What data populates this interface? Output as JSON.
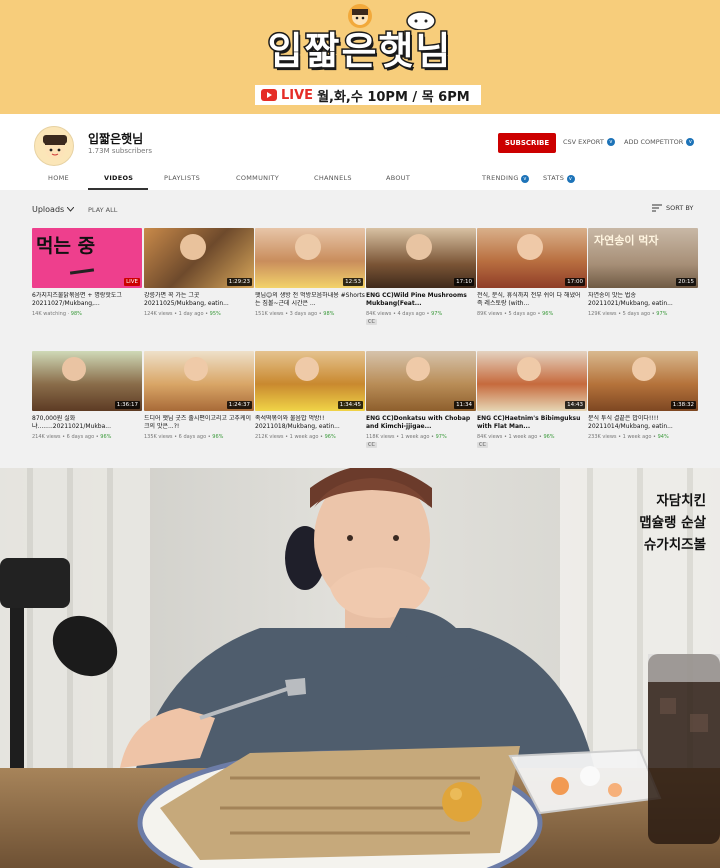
{
  "banner": {
    "title": "입짧은햇님",
    "live_word": "LIVE",
    "schedule": "월,화,수 10PM / 목 6PM"
  },
  "channel": {
    "name": "입짧은햇님",
    "subscribers": "1.73M subscribers",
    "subscribe": "SUBSCRIBE",
    "csv_export": "CSV EXPORT",
    "add_competitor": "ADD COMPETITOR",
    "tabs": [
      "HOME",
      "VIDEOS",
      "PLAYLISTS",
      "COMMUNITY",
      "CHANNELS",
      "ABOUT",
      "TRENDING",
      "STATS"
    ],
    "active_tab": "VIDEOS"
  },
  "videos_toolbar": {
    "uploads": "Uploads",
    "play_all": "PLAY ALL",
    "sort_by": "SORT BY"
  },
  "videos": [
    {
      "title": "6가지치즈불닭볶음면 + 명랑핫도그 20211027/Mukbang,...",
      "badge": "LIVE",
      "views": "14K watching",
      "age": "",
      "pct": "98%",
      "cc": false
    },
    {
      "title": "강릉가면 꼭 가는 그곳 20211025/Mukbang, eatin...",
      "badge": "1:29:23",
      "views": "124K views",
      "age": "1 day ago",
      "pct": "95%",
      "cc": false
    },
    {
      "title": "햇님😊의 생방 전 먹방모음하내용 #Shorts는 짐볼~근데 시간은 ...",
      "badge": "12:53",
      "views": "151K views",
      "age": "3 days ago",
      "pct": "98%",
      "cc": false
    },
    {
      "title": "ENG CC)Wild Pine Mushrooms Mukbang(Feat...",
      "badge": "17:10",
      "views": "84K views",
      "age": "4 days ago",
      "pct": "97%",
      "cc": true
    },
    {
      "title": "전식, 분식, 휴식까지 전부 쉬이 다 해냈어 즉 레스토랑 (with...",
      "badge": "17:00",
      "views": "89K views",
      "age": "5 days ago",
      "pct": "96%",
      "cc": false
    },
    {
      "title": "자연송이 맛는 법송 20211021/Mukbang, eatin...",
      "badge": "20:15",
      "views": "129K views",
      "age": "5 days ago",
      "pct": "97%",
      "cc": false
    },
    {
      "title": "870,000원 실화 냐........20211021/Mukba...",
      "badge": "1:36:17",
      "views": "214K views",
      "age": "6 days ago",
      "pct": "96%",
      "cc": false
    },
    {
      "title": "드디어 햇님 굿즈 출시편이고리고 고추케이크의 맛은...?!",
      "badge": "1:24:37",
      "views": "135K views",
      "age": "6 days ago",
      "pct": "96%",
      "cc": false
    },
    {
      "title": "족석떡볶이와 불음밥 먹방!! 20211018/Mukbang, eatin...",
      "badge": "1:34:45",
      "views": "212K views",
      "age": "1 week ago",
      "pct": "96%",
      "cc": false
    },
    {
      "title": "ENG CC)Donkatsu with Chobap and Kimchi-jjigae...",
      "badge": "11:34",
      "views": "118K views",
      "age": "1 week ago",
      "pct": "97%",
      "cc": true
    },
    {
      "title": "ENG CC)Haetnim's Bibimguksu with Flat Man...",
      "badge": "14:43",
      "views": "84K views",
      "age": "1 week ago",
      "pct": "96%",
      "cc": true
    },
    {
      "title": "분식 투식 결끝은 밥이다!!!! 20211014/Mukbang, eatin...",
      "badge": "1:38:32",
      "views": "233K views",
      "age": "1 week ago",
      "pct": "94%",
      "cc": false
    }
  ],
  "thumb_texts": [
    "먹는 중",
    "",
    "",
    "",
    "",
    "자연송이 먹자",
    "",
    "",
    "",
    "",
    "",
    ""
  ],
  "photo_caption": [
    "자담치킨",
    "맵슐랭 순살",
    "슈가치즈볼"
  ],
  "colors": {
    "banner_bg": "#f7cd7b",
    "subscribe_red": "#cc0000",
    "live_red": "#e52d27",
    "panel_bg": "#f1f1f1",
    "good_pct": "#3a9a3a"
  }
}
